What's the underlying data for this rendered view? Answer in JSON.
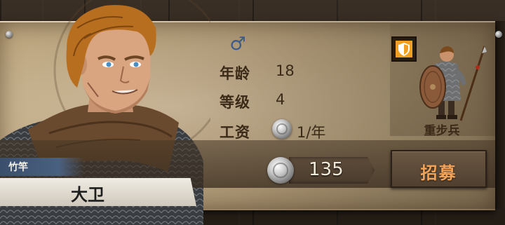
{
  "recruit": {
    "gender_icon": "male-symbol",
    "gender_symbol": "♂",
    "stats": {
      "age_label": "年龄",
      "age_value": "18",
      "level_label": "等级",
      "level_value": "4",
      "wage_label": "工资",
      "wage_value": "1/年"
    },
    "unit_type": "重步兵",
    "nickname": "竹竿",
    "name": "大卫",
    "price": "135",
    "recruit_button_label": "招募",
    "colors": {
      "recruit_label": "#f2a35a",
      "gender": "#3c5a8a",
      "badge": "#f0a020"
    }
  }
}
